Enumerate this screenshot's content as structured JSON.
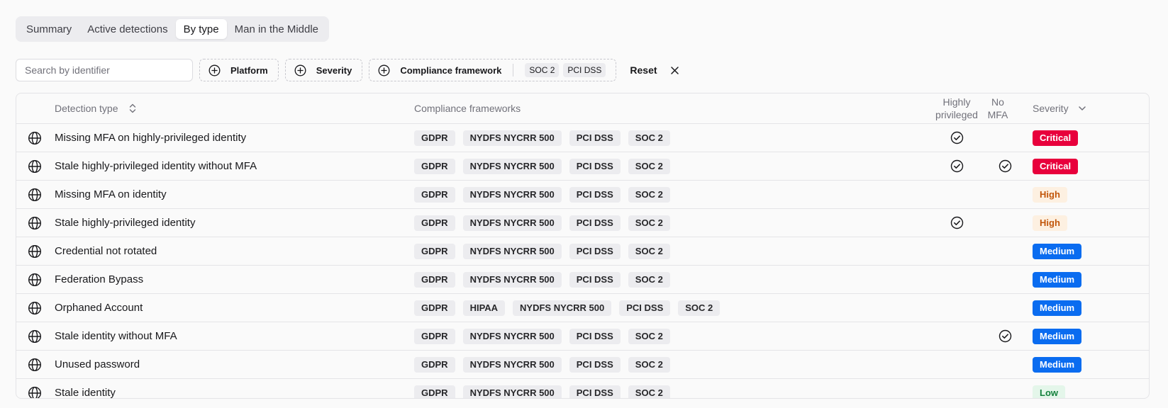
{
  "tabs": [
    {
      "label": "Summary",
      "active": false
    },
    {
      "label": "Active detections",
      "active": false
    },
    {
      "label": "By type",
      "active": true
    },
    {
      "label": "Man in the Middle",
      "active": false
    }
  ],
  "filters": {
    "search_placeholder": "Search by identifier",
    "search_value": "",
    "platform_label": "Platform",
    "severity_label": "Severity",
    "compliance_label": "Compliance framework",
    "compliance_selected": [
      "SOC 2",
      "PCI DSS"
    ],
    "reset_label": "Reset"
  },
  "table": {
    "columns": {
      "detection_type": "Detection type",
      "compliance": "Compliance frameworks",
      "highly_privileged": "Highly privileged",
      "no_mfa": "No MFA",
      "severity": "Severity"
    },
    "rows": [
      {
        "name": "Missing MFA on highly-privileged identity",
        "frameworks": [
          "GDPR",
          "NYDFS NYCRR 500",
          "PCI DSS",
          "SOC 2"
        ],
        "highly_privileged": true,
        "no_mfa": false,
        "severity": "Critical",
        "severity_level": "critical"
      },
      {
        "name": "Stale highly-privileged identity without MFA",
        "frameworks": [
          "GDPR",
          "NYDFS NYCRR 500",
          "PCI DSS",
          "SOC 2"
        ],
        "highly_privileged": true,
        "no_mfa": true,
        "severity": "Critical",
        "severity_level": "critical"
      },
      {
        "name": "Missing MFA on identity",
        "frameworks": [
          "GDPR",
          "NYDFS NYCRR 500",
          "PCI DSS",
          "SOC 2"
        ],
        "highly_privileged": false,
        "no_mfa": false,
        "severity": "High",
        "severity_level": "high"
      },
      {
        "name": "Stale highly-privileged identity",
        "frameworks": [
          "GDPR",
          "NYDFS NYCRR 500",
          "PCI DSS",
          "SOC 2"
        ],
        "highly_privileged": true,
        "no_mfa": false,
        "severity": "High",
        "severity_level": "high"
      },
      {
        "name": "Credential not rotated",
        "frameworks": [
          "GDPR",
          "NYDFS NYCRR 500",
          "PCI DSS",
          "SOC 2"
        ],
        "highly_privileged": false,
        "no_mfa": false,
        "severity": "Medium",
        "severity_level": "medium"
      },
      {
        "name": "Federation Bypass",
        "frameworks": [
          "GDPR",
          "NYDFS NYCRR 500",
          "PCI DSS",
          "SOC 2"
        ],
        "highly_privileged": false,
        "no_mfa": false,
        "severity": "Medium",
        "severity_level": "medium"
      },
      {
        "name": "Orphaned Account",
        "frameworks": [
          "GDPR",
          "HIPAA",
          "NYDFS NYCRR 500",
          "PCI DSS",
          "SOC 2"
        ],
        "highly_privileged": false,
        "no_mfa": false,
        "severity": "Medium",
        "severity_level": "medium"
      },
      {
        "name": "Stale identity without MFA",
        "frameworks": [
          "GDPR",
          "NYDFS NYCRR 500",
          "PCI DSS",
          "SOC 2"
        ],
        "highly_privileged": false,
        "no_mfa": true,
        "severity": "Medium",
        "severity_level": "medium"
      },
      {
        "name": "Unused password",
        "frameworks": [
          "GDPR",
          "NYDFS NYCRR 500",
          "PCI DSS",
          "SOC 2"
        ],
        "highly_privileged": false,
        "no_mfa": false,
        "severity": "Medium",
        "severity_level": "medium"
      },
      {
        "name": "Stale identity",
        "frameworks": [
          "GDPR",
          "NYDFS NYCRR 500",
          "PCI DSS",
          "SOC 2"
        ],
        "highly_privileged": false,
        "no_mfa": false,
        "severity": "Low",
        "severity_level": "low"
      }
    ]
  },
  "icons": {
    "row_icon": "globe-icon",
    "flag_icon": "check-circle-icon",
    "filter_icon": "plus-circle-icon",
    "sort_icon": "sort-icon",
    "severity_sort_icon": "chevron-down-icon",
    "reset_icon": "close-icon"
  },
  "colors": {
    "critical": "#e8003c",
    "high_bg": "#fdf0e1",
    "high_text": "#c2560a",
    "medium": "#0a6cf0",
    "low_bg": "#e4f6ea",
    "low_text": "#15803d"
  }
}
